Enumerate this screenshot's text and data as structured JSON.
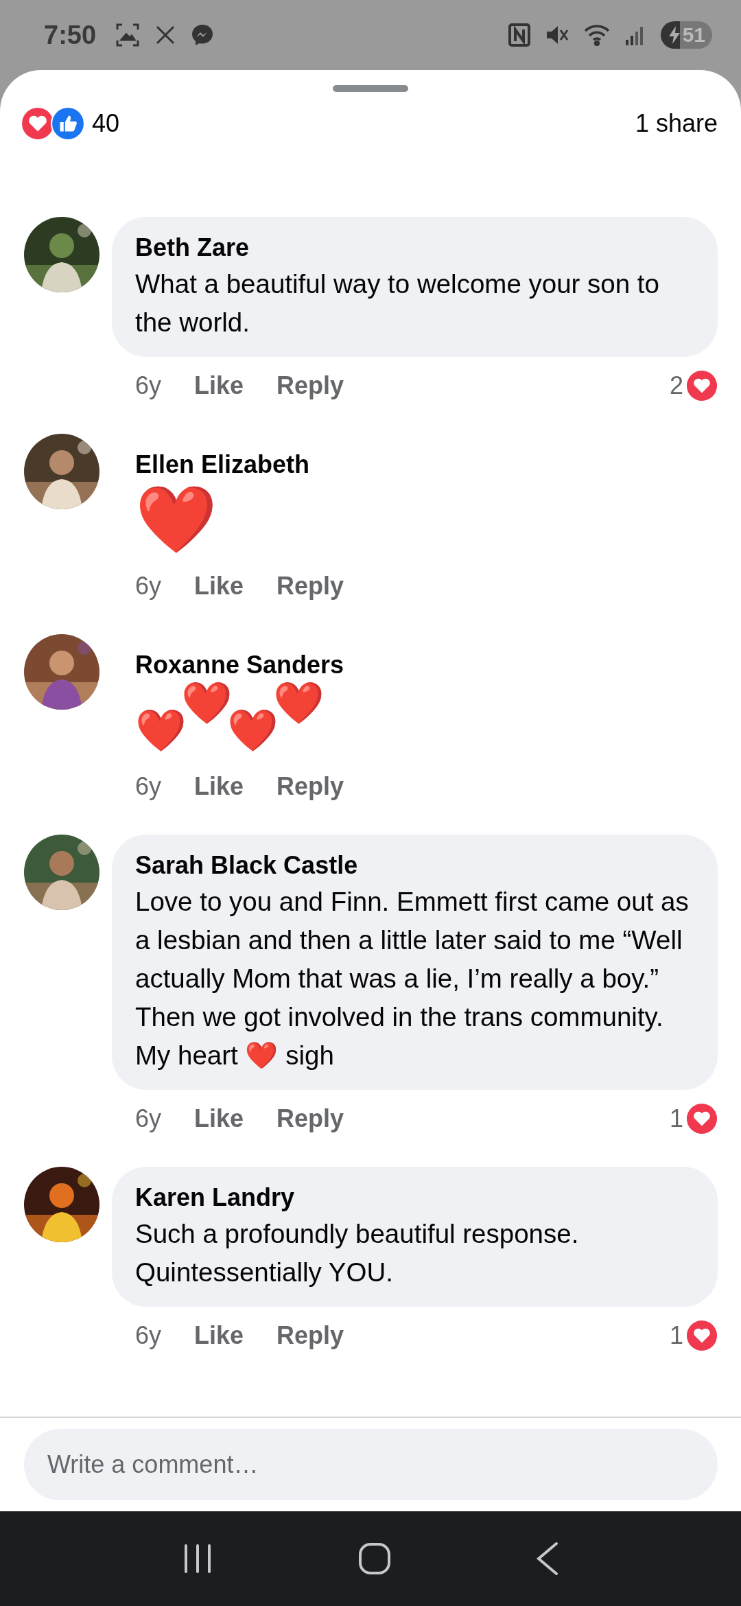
{
  "status_bar": {
    "time": "7:50",
    "battery": "51"
  },
  "header": {
    "reaction_count": "40",
    "shares": "1 share"
  },
  "comments": [
    {
      "kind": "bubble",
      "name": "Beth Zare",
      "text": "What a beautiful way to welcome your son to the world.",
      "age": "6y",
      "like": "Like",
      "reply": "Reply",
      "reactions": "2"
    },
    {
      "kind": "emoji",
      "name": "Ellen Elizabeth",
      "text": "❤️",
      "age": "6y",
      "like": "Like",
      "reply": "Reply"
    },
    {
      "kind": "emoji_wave",
      "name": "Roxanne Sanders",
      "emojis": [
        "❤️",
        "❤️",
        "❤️",
        "❤️"
      ],
      "age": "6y",
      "like": "Like",
      "reply": "Reply"
    },
    {
      "kind": "bubble",
      "name": "Sarah Black Castle",
      "text": "Love to you and Finn. Emmett first came out as a lesbian and then a little later said to me “Well actually Mom that was a lie, I’m really a boy.” Then we got involved in the trans community. My heart ❤️ sigh",
      "age": "6y",
      "like": "Like",
      "reply": "Reply",
      "reactions": "1"
    },
    {
      "kind": "bubble",
      "name": "Karen Landry",
      "text": "Such a profoundly beautiful response. Quintessentially YOU.",
      "age": "6y",
      "like": "Like",
      "reply": "Reply",
      "reactions": "1"
    }
  ],
  "composer": {
    "placeholder": "Write a comment…"
  }
}
